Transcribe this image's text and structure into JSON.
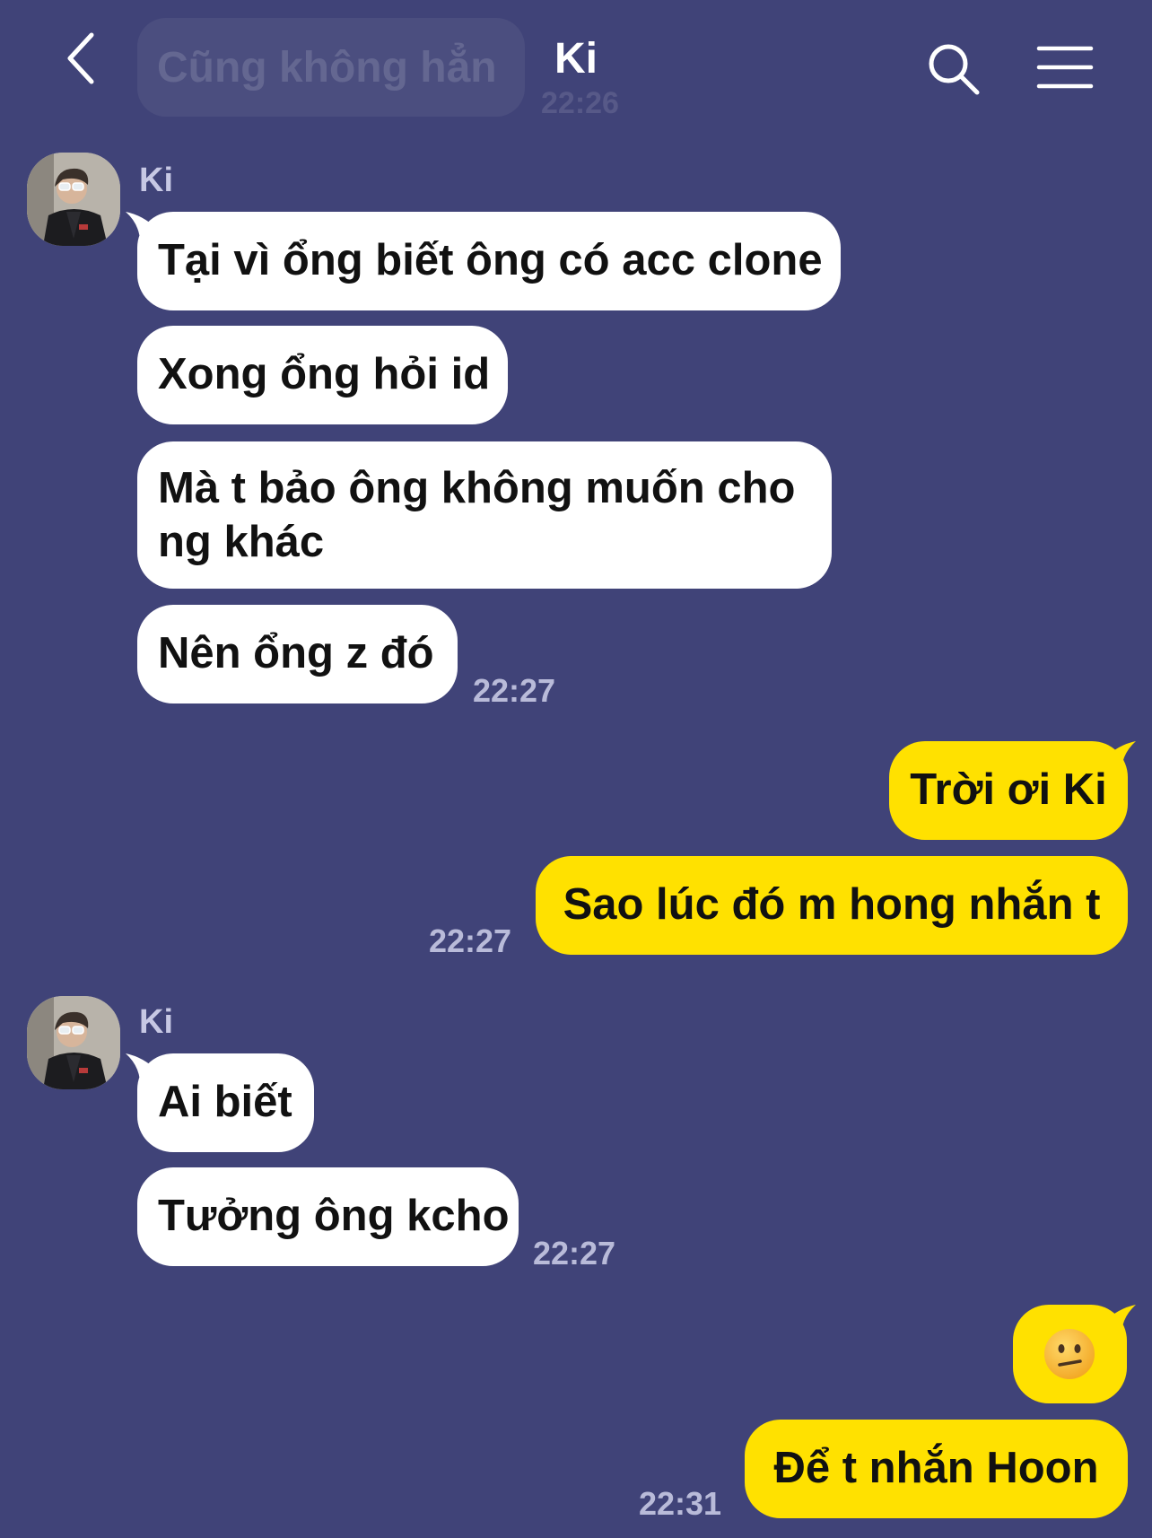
{
  "header": {
    "title": "Ki",
    "back_icon": "chevron-left-icon",
    "search_icon": "search-icon",
    "menu_icon": "hamburger-menu-icon",
    "previous_message_preview": "Cũng không hẳn",
    "previous_message_time": "22:26"
  },
  "colors": {
    "background": "#404378",
    "incoming_bubble": "#ffffff",
    "outgoing_bubble": "#ffe100",
    "timestamp": "#b9bbd9"
  },
  "messages": [
    {
      "sender": "Ki",
      "direction": "incoming",
      "bubbles": [
        "Tại vì ổng biết ông có acc clone",
        "Xong ổng hỏi id",
        "Mà t bảo ông không muốn cho ng khác",
        "Nên ổng z đó"
      ],
      "time": "22:27"
    },
    {
      "sender": "me",
      "direction": "outgoing",
      "bubbles": [
        "Trời ơi Ki",
        "Sao lúc đó m hong nhắn t"
      ],
      "time": "22:27"
    },
    {
      "sender": "Ki",
      "direction": "incoming",
      "bubbles": [
        "Ai biết",
        "Tưởng ông kcho"
      ],
      "time": "22:27"
    },
    {
      "sender": "me",
      "direction": "outgoing",
      "bubbles": [
        "😕",
        "Để t nhắn Hoon"
      ],
      "emoji_icon": "confused-face-emoji",
      "time": "22:31"
    }
  ]
}
